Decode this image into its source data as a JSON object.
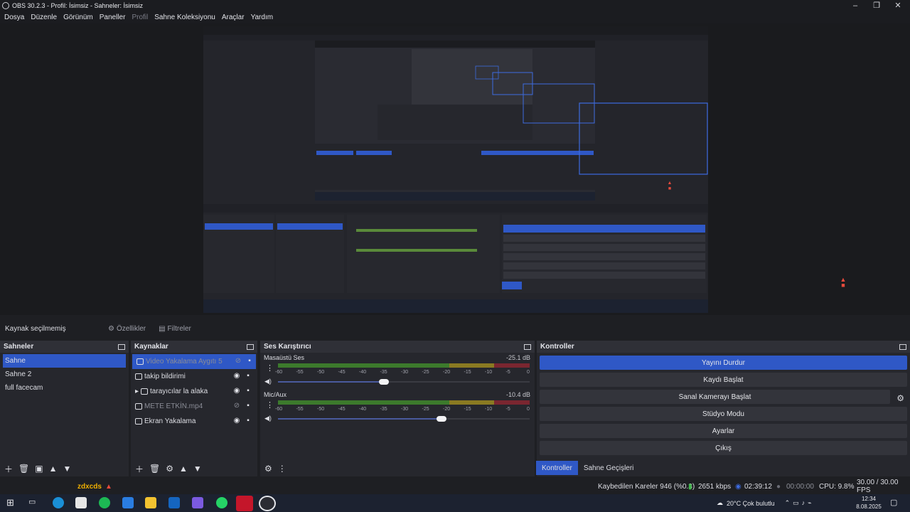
{
  "window": {
    "title": "OBS 30.2.3 - Profil: İsimsiz - Sahneler: İsimsiz",
    "controls": {
      "minimize": "–",
      "restore": "❐",
      "close": "✕"
    }
  },
  "menu": [
    {
      "label": "Dosya",
      "dim": false
    },
    {
      "label": "Düzenle",
      "dim": false
    },
    {
      "label": "Görünüm",
      "dim": false
    },
    {
      "label": "Paneller",
      "dim": false
    },
    {
      "label": "Profil",
      "dim": true
    },
    {
      "label": "Sahne Koleksiyonu",
      "dim": false
    },
    {
      "label": "Araçlar",
      "dim": false
    },
    {
      "label": "Yardım",
      "dim": false
    }
  ],
  "source_bar": {
    "label": "Kaynak seçilmemiş",
    "properties": "Özellikler",
    "filters": "Filtreler"
  },
  "scenes": {
    "title": "Sahneler",
    "items": [
      {
        "label": "Sahne",
        "selected": true
      },
      {
        "label": "Sahne 2",
        "selected": false
      },
      {
        "label": "full facecam",
        "selected": false
      }
    ]
  },
  "sources": {
    "title": "Kaynaklar",
    "items": [
      {
        "label": "Video Yakalama Aygıtı 5",
        "selected": true,
        "visible": false
      },
      {
        "label": "takip bildirimi",
        "selected": false,
        "visible": true
      },
      {
        "label": "tarayıcılar la alaka",
        "selected": false,
        "visible": true,
        "group": true
      },
      {
        "label": "METE ETKİN.mp4",
        "selected": false,
        "visible": false
      },
      {
        "label": "Ekran Yakalama",
        "selected": false,
        "visible": true
      }
    ]
  },
  "mixer": {
    "title": "Ses Karıştırıcı",
    "ticks": [
      "-60",
      "-55",
      "-50",
      "-45",
      "-40",
      "-35",
      "-30",
      "-25",
      "-20",
      "-15",
      "-10",
      "-5",
      "0"
    ],
    "channels": [
      {
        "name": "Masaüstü Ses",
        "db": "-25.1 dB",
        "volume": 0.42
      },
      {
        "name": "Mic/Aux",
        "db": "-10.4 dB",
        "volume": 0.65
      }
    ]
  },
  "controls": {
    "title": "Kontroller",
    "buttons": [
      {
        "label": "Yayını Durdur",
        "primary": true
      },
      {
        "label": "Kaydı Başlat",
        "primary": false
      },
      {
        "label": "Sanal Kamerayı Başlat",
        "primary": false
      },
      {
        "label": "Stüdyo Modu",
        "primary": false
      },
      {
        "label": "Ayarlar",
        "primary": false
      },
      {
        "label": "Çıkış",
        "primary": false
      }
    ],
    "tabs": [
      "Kontroller",
      "Sahne Geçişleri"
    ]
  },
  "status": {
    "branding": "zdxcds",
    "dropped_frames": "Kaybedilen Kareler 946 (%0.3)",
    "bitrate": "2651 kbps",
    "stream_time": "02:39:12",
    "record_time": "00:00:00",
    "cpu": "CPU: 9.8%",
    "fps": "30.00 / 30.00 FPS"
  },
  "taskbar": {
    "weather": "20°C  Çok bulutlu",
    "time": "12:34",
    "date": "8.08.2025"
  },
  "colors": {
    "accent": "#2f58c6",
    "panel": "#26272d",
    "bg": "#1e1f23"
  }
}
